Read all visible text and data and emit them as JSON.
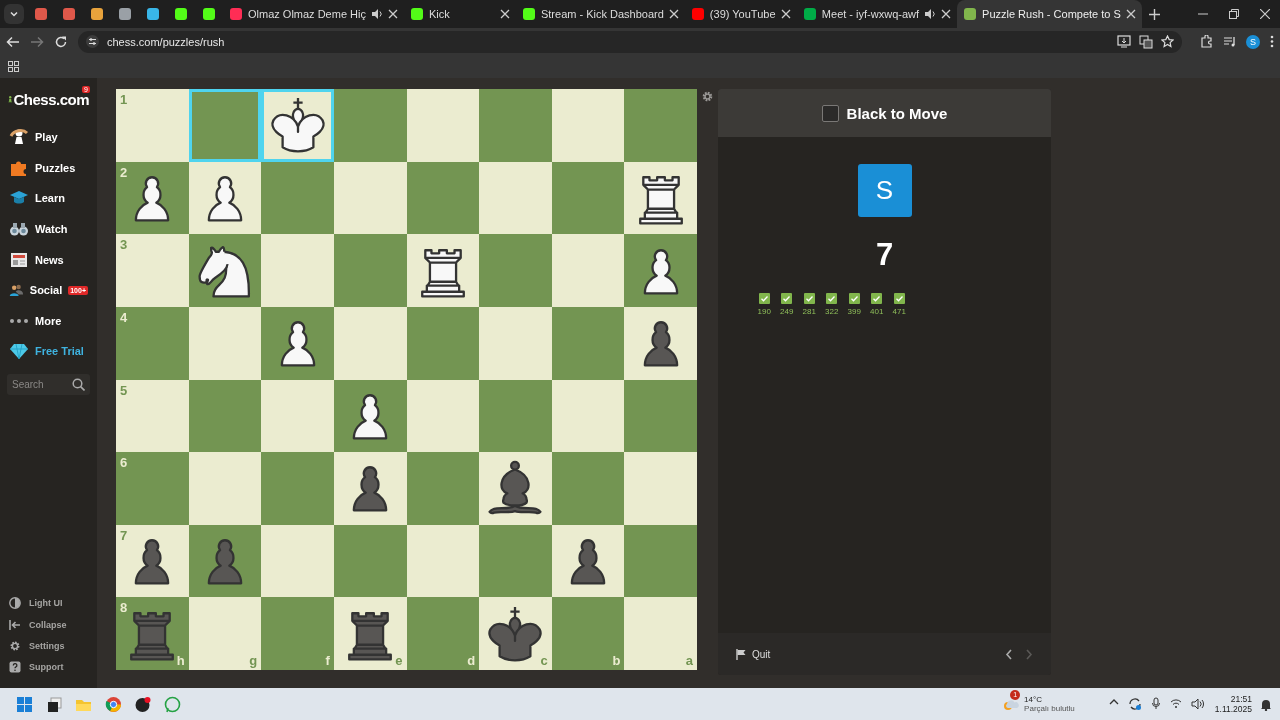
{
  "browser": {
    "tabs": [
      {
        "kind": "pinned",
        "color": "#e0584a"
      },
      {
        "kind": "pinned",
        "color": "#e0584a"
      },
      {
        "kind": "pinned",
        "color": "#e8a33c"
      },
      {
        "kind": "pinned",
        "color": "#9aa0a6"
      },
      {
        "kind": "pinned",
        "color": "#39b6e8"
      },
      {
        "kind": "pinned",
        "color": "#53fc18"
      },
      {
        "kind": "pinned",
        "color": "#53fc18"
      },
      {
        "kind": "page",
        "title": "Olmaz Olmaz Deme Hiç",
        "color": "#ff2d55",
        "audio": true,
        "selected": false
      },
      {
        "kind": "page",
        "title": "Kick",
        "color": "#53fc18",
        "audio": false,
        "selected": false
      },
      {
        "kind": "page",
        "title": "Stream - Kick Dashboard",
        "color": "#53fc18",
        "audio": false,
        "selected": false
      },
      {
        "kind": "page",
        "title": "(39) YouTube",
        "color": "#ff0000",
        "audio": false,
        "selected": false
      },
      {
        "kind": "page",
        "title": "Meet - iyf-wxwq-awf",
        "color": "#00ac47",
        "audio": true,
        "selected": false
      },
      {
        "kind": "page",
        "title": "Puzzle Rush - Compete to S",
        "color": "#81b64c",
        "audio": false,
        "selected": true
      }
    ],
    "address": "chess.com/puzzles/rush",
    "profile": "S"
  },
  "sidebar": {
    "logo": "Chess.com",
    "logo_badge": "9",
    "items": [
      {
        "label": "Play",
        "kind": "nav"
      },
      {
        "label": "Puzzles",
        "kind": "nav"
      },
      {
        "label": "Learn",
        "kind": "nav"
      },
      {
        "label": "Watch",
        "kind": "nav"
      },
      {
        "label": "News",
        "kind": "nav"
      },
      {
        "label": "Social",
        "kind": "nav",
        "badge": "100+"
      },
      {
        "label": "More",
        "kind": "nav"
      },
      {
        "label": "Free Trial",
        "kind": "promo"
      }
    ],
    "search": {
      "placeholder": "Search"
    },
    "footer_items": [
      "Light UI",
      "Collapse",
      "Settings",
      "Support"
    ]
  },
  "board": {
    "rows": [
      {
        "rank": "1",
        "squares": [
          {
            "highlighted": false
          },
          {
            "highlighted": true
          },
          {
            "kind": "king",
            "color": "#f8f8f8",
            "highlighted": true
          },
          {
            "highlighted": false
          },
          {
            "highlighted": false
          },
          {
            "highlighted": false
          },
          {
            "highlighted": false
          },
          {
            "highlighted": false
          }
        ]
      },
      {
        "rank": "2",
        "squares": [
          {
            "kind": "pawn",
            "color": "#f8f8f8",
            "highlighted": false
          },
          {
            "kind": "pawn",
            "color": "#f8f8f8",
            "highlighted": false
          },
          {
            "highlighted": false
          },
          {
            "highlighted": false
          },
          {
            "highlighted": false
          },
          {
            "highlighted": false
          },
          {
            "highlighted": false
          },
          {
            "kind": "rook",
            "color": "#f8f8f8",
            "highlighted": false
          }
        ]
      },
      {
        "rank": "3",
        "squares": [
          {
            "highlighted": false
          },
          {
            "kind": "knight",
            "color": "#f8f8f8",
            "highlighted": false
          },
          {
            "highlighted": false
          },
          {
            "highlighted": false
          },
          {
            "kind": "rook",
            "color": "#f8f8f8",
            "highlighted": false
          },
          {
            "highlighted": false
          },
          {
            "highlighted": false
          },
          {
            "kind": "pawn",
            "color": "#f8f8f8",
            "highlighted": false
          }
        ]
      },
      {
        "rank": "4",
        "squares": [
          {
            "highlighted": false
          },
          {
            "highlighted": false
          },
          {
            "kind": "pawn",
            "color": "#f8f8f8",
            "highlighted": false
          },
          {
            "highlighted": false
          },
          {
            "highlighted": false
          },
          {
            "highlighted": false
          },
          {
            "highlighted": false
          },
          {
            "kind": "pawn",
            "color": "#585654",
            "highlighted": false
          }
        ]
      },
      {
        "rank": "5",
        "squares": [
          {
            "highlighted": false
          },
          {
            "highlighted": false
          },
          {
            "highlighted": false
          },
          {
            "kind": "pawn",
            "color": "#f8f8f8",
            "highlighted": false
          },
          {
            "highlighted": false
          },
          {
            "highlighted": false
          },
          {
            "highlighted": false
          },
          {
            "highlighted": false
          }
        ]
      },
      {
        "rank": "6",
        "squares": [
          {
            "highlighted": false
          },
          {
            "highlighted": false
          },
          {
            "highlighted": false
          },
          {
            "kind": "pawn",
            "color": "#585654",
            "highlighted": false
          },
          {
            "highlighted": false
          },
          {
            "kind": "bishop",
            "color": "#585654",
            "highlighted": false
          },
          {
            "highlighted": false
          },
          {
            "highlighted": false
          }
        ]
      },
      {
        "rank": "7",
        "squares": [
          {
            "kind": "pawn",
            "color": "#585654",
            "highlighted": false
          },
          {
            "kind": "pawn",
            "color": "#585654",
            "highlighted": false
          },
          {
            "highlighted": false
          },
          {
            "highlighted": false
          },
          {
            "highlighted": false
          },
          {
            "highlighted": false
          },
          {
            "kind": "pawn",
            "color": "#585654",
            "highlighted": false
          },
          {
            "highlighted": false
          }
        ]
      },
      {
        "rank": "8",
        "squares": [
          {
            "kind": "rook",
            "color": "#585654",
            "highlighted": false
          },
          {
            "highlighted": false
          },
          {
            "highlighted": false
          },
          {
            "kind": "rook",
            "color": "#585654",
            "highlighted": false
          },
          {
            "highlighted": false
          },
          {
            "kind": "king",
            "color": "#585654",
            "highlighted": false
          },
          {
            "highlighted": false
          },
          {
            "highlighted": false
          }
        ]
      }
    ],
    "files": [
      "h",
      "g",
      "f",
      "e",
      "d",
      "c",
      "b",
      "a"
    ]
  },
  "panel": {
    "turn": {
      "label": "Black to Move",
      "color": "#2b2a29"
    },
    "avatar": "S",
    "score": "7",
    "solved": [
      {
        "rating": "190",
        "correct": true
      },
      {
        "rating": "249",
        "correct": true
      },
      {
        "rating": "281",
        "correct": true
      },
      {
        "rating": "322",
        "correct": true
      },
      {
        "rating": "399",
        "correct": true
      },
      {
        "rating": "401",
        "correct": true
      },
      {
        "rating": "471",
        "correct": true
      }
    ],
    "quit": "Quit",
    "nav": [
      {
        "kind": "prev",
        "disabled": false
      },
      {
        "kind": "next",
        "disabled": true
      }
    ]
  },
  "taskbar": {
    "weather": {
      "temp": "14°C",
      "desc": "Parçalı bulutlu",
      "badge": "1"
    },
    "time": "21:51",
    "date": "1.11.2025"
  }
}
